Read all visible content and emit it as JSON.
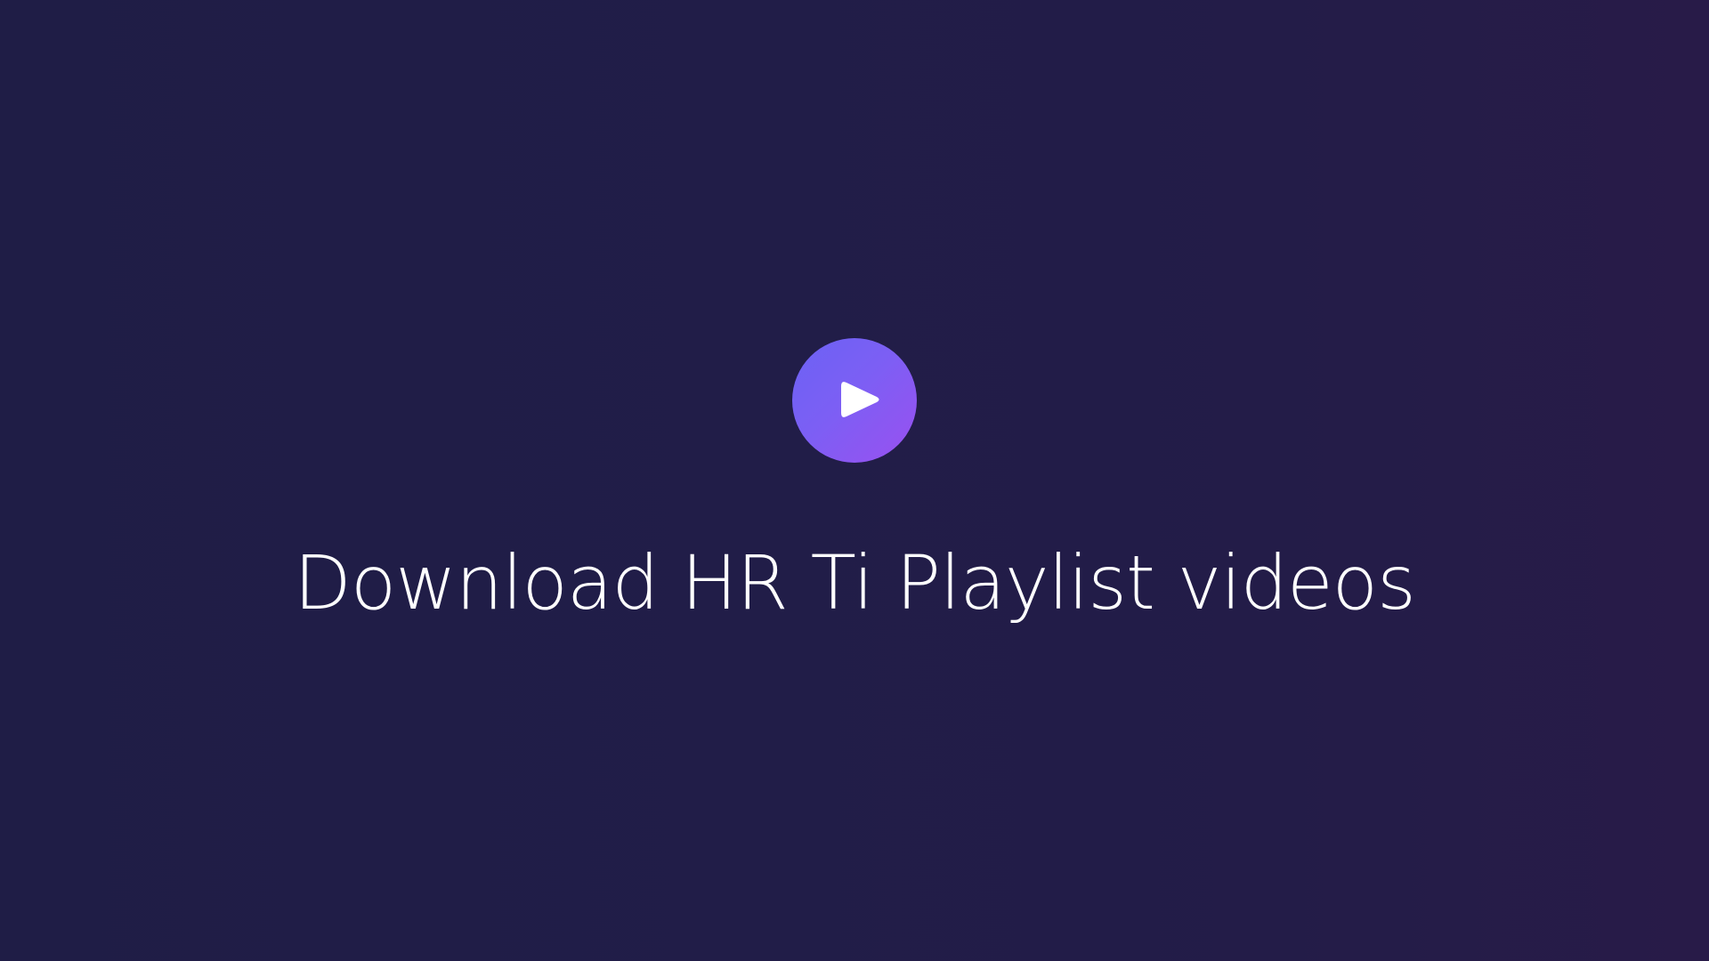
{
  "hero": {
    "title": "Download HR Ti Playlist videos",
    "play_icon": "play-icon"
  },
  "colors": {
    "background_start": "#1f1d46",
    "background_end": "#281b48",
    "accent_start": "#6b62f5",
    "accent_end": "#9a50f0",
    "text": "#ffffff"
  }
}
